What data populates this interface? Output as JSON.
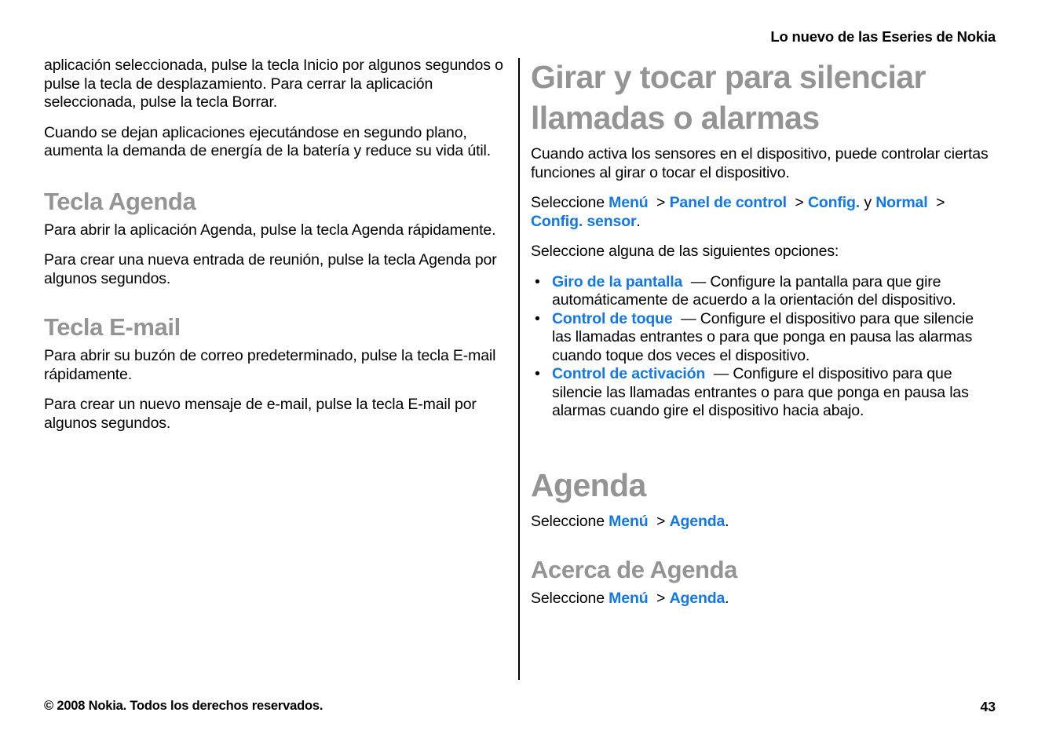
{
  "document": {
    "running_head": "Lo nuevo de las Eseries de Nokia",
    "page_number": "43",
    "copyright": "© 2008 Nokia. Todos los derechos reservados.",
    "link_color": "#1278e8",
    "heading_color": "#949494",
    "body_color": "#000000"
  },
  "left_column": {
    "paragraph_1": "aplicación seleccionada, pulse la tecla Inicio por algunos segundos o pulse la tecla de desplazamiento. Para cerrar la aplicación seleccionada, pulse la tecla Borrar.",
    "paragraph_2": "Cuando se dejan aplicaciones ejecutándose en segundo plano, aumenta la demanda de energía de la batería y reduce su vida útil.",
    "section_tecla_agenda": {
      "heading": "Tecla Agenda",
      "paragraph_1": "Para abrir la aplicación Agenda, pulse la tecla Agenda rápidamente.",
      "paragraph_2": "Para crear una nueva entrada de reunión, pulse la tecla Agenda por algunos segundos."
    },
    "section_tecla_email": {
      "heading": "Tecla E-mail",
      "paragraph_1": "Para abrir su buzón de correo predeterminado, pulse la tecla E-mail rápidamente.",
      "paragraph_2": "Para crear un nuevo mensaje de e-mail, pulse la tecla E-mail por algunos segundos."
    }
  },
  "right_column": {
    "section_girar": {
      "heading": "Girar y tocar para silenciar llamadas o alarmas",
      "paragraph_1": "Cuando activa los sensores en el dispositivo, puede controlar ciertas funciones al girar o tocar el dispositivo.",
      "path_intro": "Seleccione ",
      "path_links": {
        "link_1": "Menú",
        "sep_1": ">",
        "link_2": "Panel de control",
        "sep_2": ">",
        "link_3": "Config.",
        "conjunction": "y",
        "link_4": "Normal",
        "sep_3": ">",
        "link_5": "Config. sensor",
        "period": "."
      },
      "options_intro": "Seleccione alguna de las siguientes opciones:",
      "bullet": "•",
      "options": [
        {
          "term": "Giro de la pantalla",
          "dash": "—",
          "description": "Configure la pantalla para que gire automáticamente de acuerdo a la orientación del dispositivo."
        },
        {
          "term": "Control de toque",
          "dash": "—",
          "description": "Configure el dispositivo para que silencie las llamadas entrantes o para que ponga en pausa las alarmas cuando toque dos veces el dispositivo."
        },
        {
          "term": "Control de activación",
          "dash": "—",
          "description": "Configure el dispositivo para que silencie las llamadas entrantes o para que ponga en pausa las alarmas cuando gire el dispositivo hacia abajo."
        }
      ]
    },
    "section_agenda": {
      "heading": "Agenda",
      "path_intro": "Seleccione ",
      "link_1": "Menú",
      "sep_1": ">",
      "link_2": "Agenda",
      "period": "."
    },
    "section_acerca_agenda": {
      "heading": "Acerca de Agenda",
      "path_intro": "Seleccione ",
      "link_1": "Menú",
      "sep_1": ">",
      "link_2": "Agenda",
      "period": "."
    }
  }
}
